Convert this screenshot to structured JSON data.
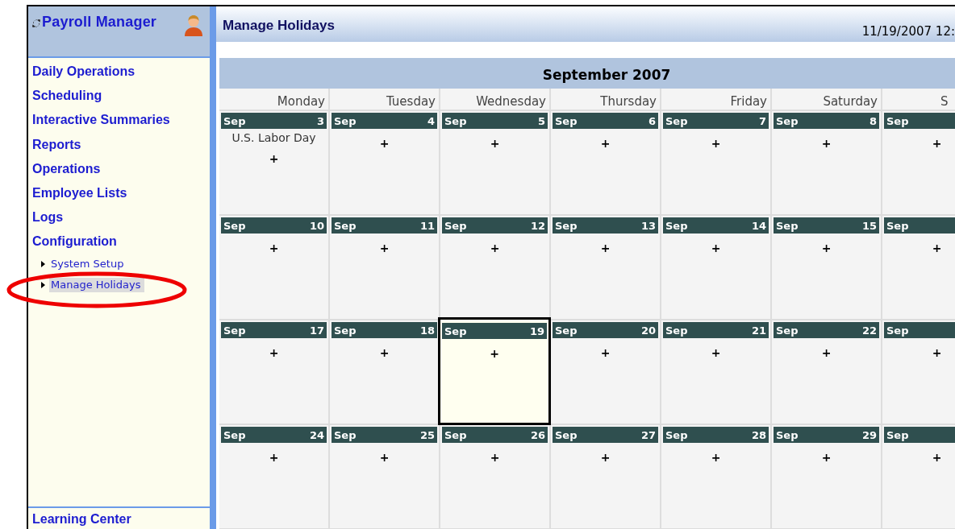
{
  "sidebar": {
    "title": "Payroll Manager",
    "items": [
      {
        "label": "Daily Operations"
      },
      {
        "label": "Scheduling"
      },
      {
        "label": "Interactive Summaries"
      },
      {
        "label": "Reports"
      },
      {
        "label": "Operations"
      },
      {
        "label": "Employee Lists"
      },
      {
        "label": "Logs"
      },
      {
        "label": "Configuration",
        "children": [
          {
            "label": "System Setup",
            "selected": false
          },
          {
            "label": "Manage Holidays",
            "selected": true
          }
        ]
      }
    ],
    "footer": "Learning Center"
  },
  "page": {
    "title": "Manage Holidays",
    "datetime": "11/19/2007 12:"
  },
  "calendar": {
    "title": "September 2007",
    "weekdays": [
      "Monday",
      "Tuesday",
      "Wednesday",
      "Thursday",
      "Friday",
      "Saturday",
      "S"
    ],
    "weeks": [
      [
        {
          "month": "Sep",
          "day": "3",
          "holiday": "U.S. Labor Day",
          "add": "+",
          "selected": false
        },
        {
          "month": "Sep",
          "day": "4",
          "add": "+",
          "selected": false
        },
        {
          "month": "Sep",
          "day": "5",
          "add": "+",
          "selected": false
        },
        {
          "month": "Sep",
          "day": "6",
          "add": "+",
          "selected": false
        },
        {
          "month": "Sep",
          "day": "7",
          "add": "+",
          "selected": false
        },
        {
          "month": "Sep",
          "day": "8",
          "add": "+",
          "selected": false
        },
        {
          "month": "Sep",
          "add": "+",
          "selected": false
        }
      ],
      [
        {
          "month": "Sep",
          "day": "10",
          "add": "+",
          "selected": false
        },
        {
          "month": "Sep",
          "day": "11",
          "add": "+",
          "selected": false
        },
        {
          "month": "Sep",
          "day": "12",
          "add": "+",
          "selected": false
        },
        {
          "month": "Sep",
          "day": "13",
          "add": "+",
          "selected": false
        },
        {
          "month": "Sep",
          "day": "14",
          "add": "+",
          "selected": false
        },
        {
          "month": "Sep",
          "day": "15",
          "add": "+",
          "selected": false
        },
        {
          "month": "Sep",
          "add": "+",
          "selected": false
        }
      ],
      [
        {
          "month": "Sep",
          "day": "17",
          "add": "+",
          "selected": false
        },
        {
          "month": "Sep",
          "day": "18",
          "add": "+",
          "selected": false
        },
        {
          "month": "Sep",
          "day": "19",
          "add": "+",
          "selected": true
        },
        {
          "month": "Sep",
          "day": "20",
          "add": "+",
          "selected": false
        },
        {
          "month": "Sep",
          "day": "21",
          "add": "+",
          "selected": false
        },
        {
          "month": "Sep",
          "day": "22",
          "add": "+",
          "selected": false
        },
        {
          "month": "Sep",
          "add": "+",
          "selected": false
        }
      ],
      [
        {
          "month": "Sep",
          "day": "24",
          "add": "+",
          "selected": false
        },
        {
          "month": "Sep",
          "day": "25",
          "add": "+",
          "selected": false
        },
        {
          "month": "Sep",
          "day": "26",
          "add": "+",
          "selected": false
        },
        {
          "month": "Sep",
          "day": "27",
          "add": "+",
          "selected": false
        },
        {
          "month": "Sep",
          "day": "28",
          "add": "+",
          "selected": false
        },
        {
          "month": "Sep",
          "day": "29",
          "add": "+",
          "selected": false
        },
        {
          "month": "Sep",
          "add": "+",
          "selected": false
        }
      ]
    ]
  }
}
